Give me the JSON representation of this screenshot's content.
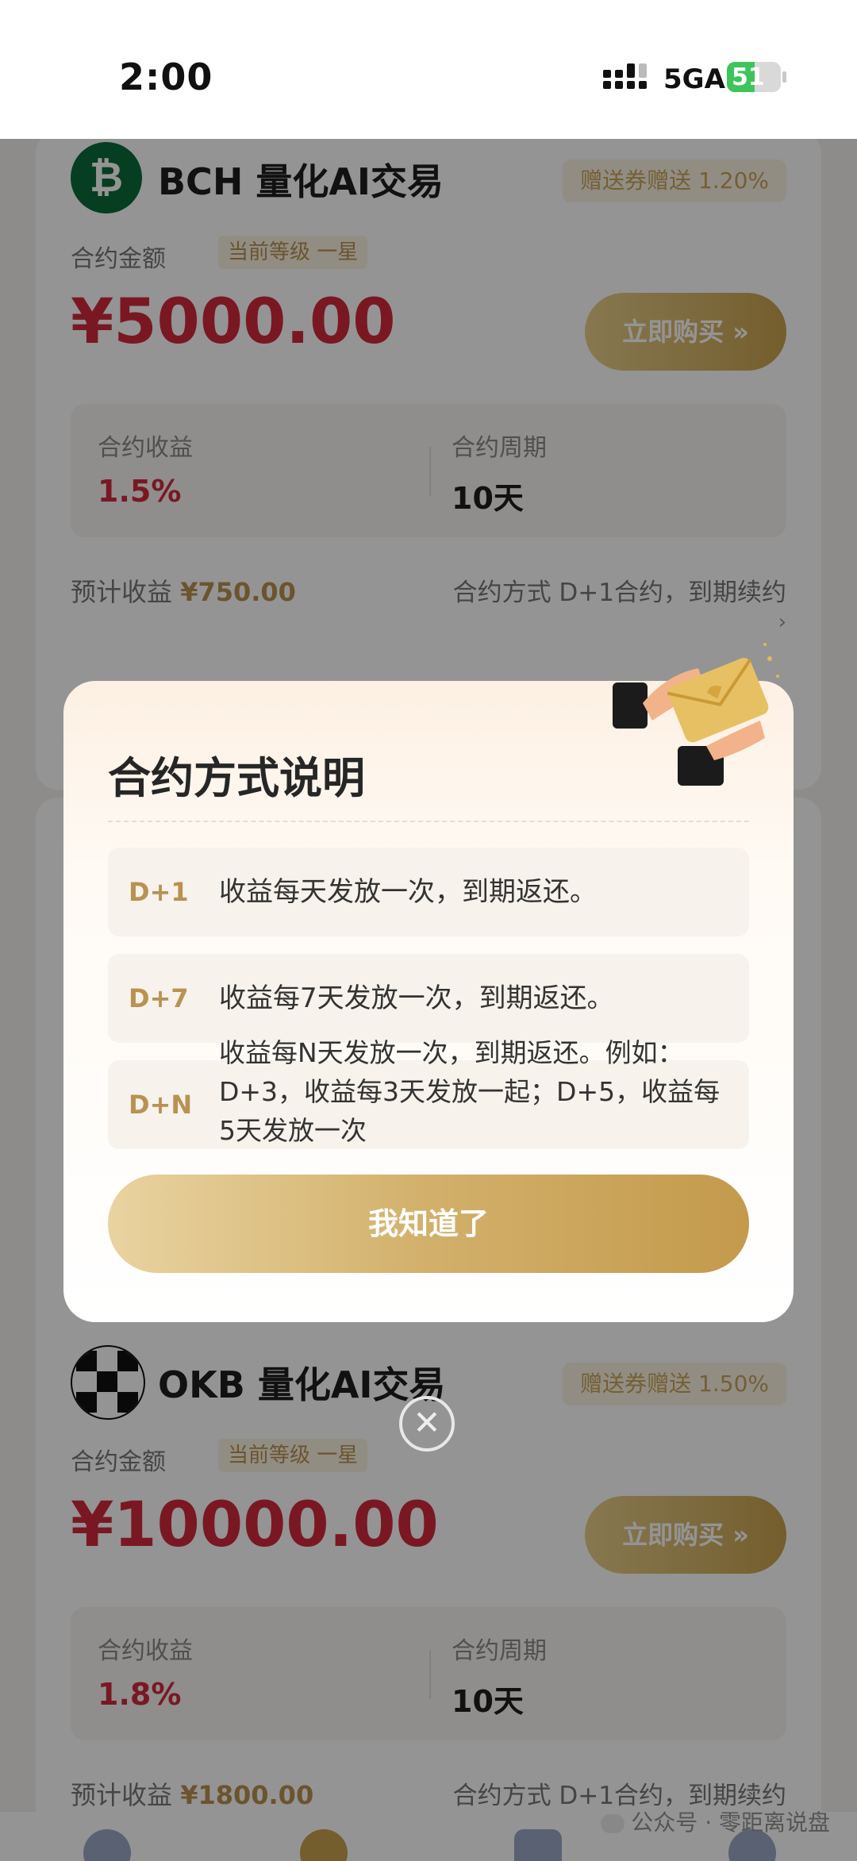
{
  "status_bar": {
    "time": "2:00",
    "network": "5GA",
    "battery": "51",
    "battery_level": 0.51
  },
  "cards": [
    {
      "coin": "BCH",
      "title": "BCH 量化AI交易",
      "bonus": "赠送券赠送 1.20%",
      "amount_label": "合约金额",
      "level": "当前等级 一星",
      "price": "¥5000.00",
      "buy_label": "立即购买 »",
      "yield_label": "合约收益",
      "yield_value": "1.5%",
      "period_label": "合约周期",
      "period_value": "10天",
      "estimate_label": "预计收益",
      "estimate_value": "¥750.00",
      "method": "合约方式  D+1合约，到期续约",
      "chevron": "›"
    },
    {
      "coin": "OKB",
      "title": "OKB 量化AI交易",
      "bonus": "赠送券赠送 1.50%",
      "amount_label": "合约金额",
      "level": "当前等级 一星",
      "price": "¥10000.00",
      "buy_label": "立即购买 »",
      "yield_label": "合约收益",
      "yield_value": "1.8%",
      "period_label": "合约周期",
      "period_value": "10天",
      "estimate_label": "预计收益",
      "estimate_value": "¥1800.00",
      "method": "合约方式  D+1合约，到期续约"
    }
  ],
  "modal": {
    "title": "合约方式说明",
    "rules": [
      {
        "code": "D+1",
        "desc": "收益每天发放一次，到期返还。"
      },
      {
        "code": "D+7",
        "desc": "收益每7天发放一次，到期返还。"
      },
      {
        "code": "D+N",
        "desc": "收益每N天发放一次，到期返还。例如：D+3，收益每3天发放一起；D+5，收益每5天发放一次"
      }
    ],
    "confirm_label": "我知道了",
    "close_symbol": "✕"
  },
  "watermark": "公众号 · 零距离说盘",
  "colors": {
    "accent_gold": "#c9a24f",
    "price_red": "#d12a3d",
    "bch_green": "#0b6b3a"
  },
  "icons": [
    "signal-icon",
    "battery-icon",
    "bitcoin-cash-logo",
    "okb-logo",
    "envelope-illustration",
    "close-icon",
    "wechat-icon"
  ]
}
